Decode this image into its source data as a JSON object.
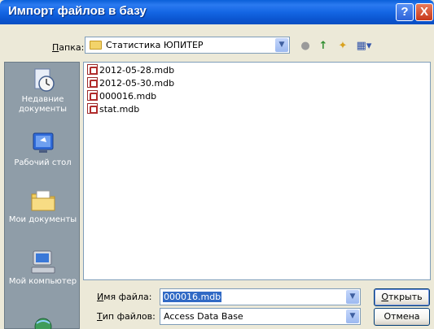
{
  "window": {
    "title": "Импорт файлов в базу",
    "help_label": "?",
    "close_label": "X"
  },
  "lookin": {
    "label_hot": "П",
    "label_rest": "апка:",
    "value": "Статистика ЮПИТЕР",
    "drop_glyph": "▼"
  },
  "toolbar": {
    "back_glyph": "●",
    "up_glyph": "↑",
    "newfolder_glyph": "✦",
    "view_glyph": "▦▾"
  },
  "places": [
    {
      "label": "Недавние документы",
      "icon": "recent-documents-icon"
    },
    {
      "label": "Рабочий стол",
      "icon": "desktop-icon"
    },
    {
      "label": "Мои документы",
      "icon": "my-documents-icon"
    },
    {
      "label": "Мой компьютер",
      "icon": "my-computer-icon"
    }
  ],
  "files": [
    {
      "name": "2012-05-28.mdb"
    },
    {
      "name": "2012-05-30.mdb"
    },
    {
      "name": "000016.mdb"
    },
    {
      "name": "stat.mdb"
    }
  ],
  "filename": {
    "label_hot": "И",
    "label_rest": "мя файла:",
    "value": "000016.mdb"
  },
  "filetype": {
    "label_hot": "Т",
    "label_rest": "ип файлов:",
    "value": "Access Data Base"
  },
  "buttons": {
    "open_hot": "О",
    "open_rest": "ткрыть",
    "cancel": "Отмена"
  },
  "colors": {
    "titlebar": "#0a5fd8",
    "places_bg": "#8f9da8",
    "selection": "#316ac5"
  }
}
